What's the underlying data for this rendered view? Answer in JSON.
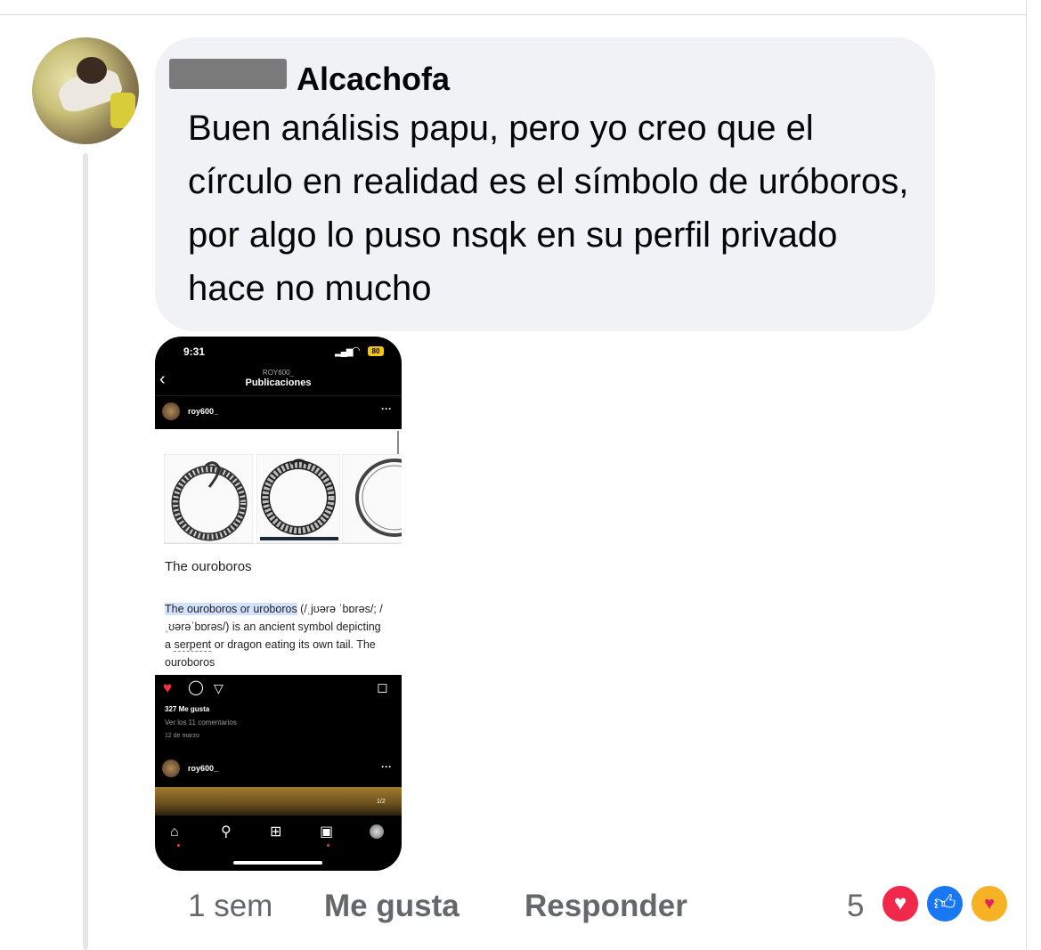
{
  "comment": {
    "author_visible": "Alcachofa",
    "text": "Buen análisis papu, pero yo creo que el círculo en realidad es el símbolo de uróboros, por algo lo puso nsqk en su perfil privado hace no mucho",
    "time": "1 sem",
    "like_label": "Me gusta",
    "reply_label": "Responder",
    "reaction_count": "5",
    "reactions": [
      "love",
      "like",
      "care"
    ]
  },
  "attachment": {
    "status_time": "9:31",
    "battery": "80",
    "header_user": "ROY600_",
    "header_title": "Publicaciones",
    "username": "roy600_",
    "post": {
      "heading": "The ouroboros",
      "desc_highlight": "The ouroboros or uroboros",
      "desc_rest_1": " (/ˌjʊərə ˈbɒrəs/; /ˌʊərəˈbɒrəs/) is an ancient symbol depicting a ",
      "desc_underlined": "serpent",
      "desc_rest_2": " or dragon eating its own tail. The ouroboros"
    },
    "likes": "327 Me gusta",
    "view_comments": "Ver los 11 comentarios",
    "date": "12 de marzo",
    "username_2": "roy600_",
    "page_indicator": "1/2"
  },
  "colors": {
    "bubble": "#f0f2f5",
    "meta_gray": "#65676b",
    "love": "#f0284a",
    "like": "#1877f2",
    "care": "#f7b125"
  },
  "icons": {
    "reactions": [
      "heart-icon",
      "thumbs-up-icon",
      "care-hug-icon"
    ],
    "phone_actions": [
      "heart-icon",
      "comment-icon",
      "send-icon",
      "bookmark-icon"
    ],
    "phone_nav": [
      "home-icon",
      "search-icon",
      "create-icon",
      "reels-icon",
      "profile-icon"
    ]
  }
}
